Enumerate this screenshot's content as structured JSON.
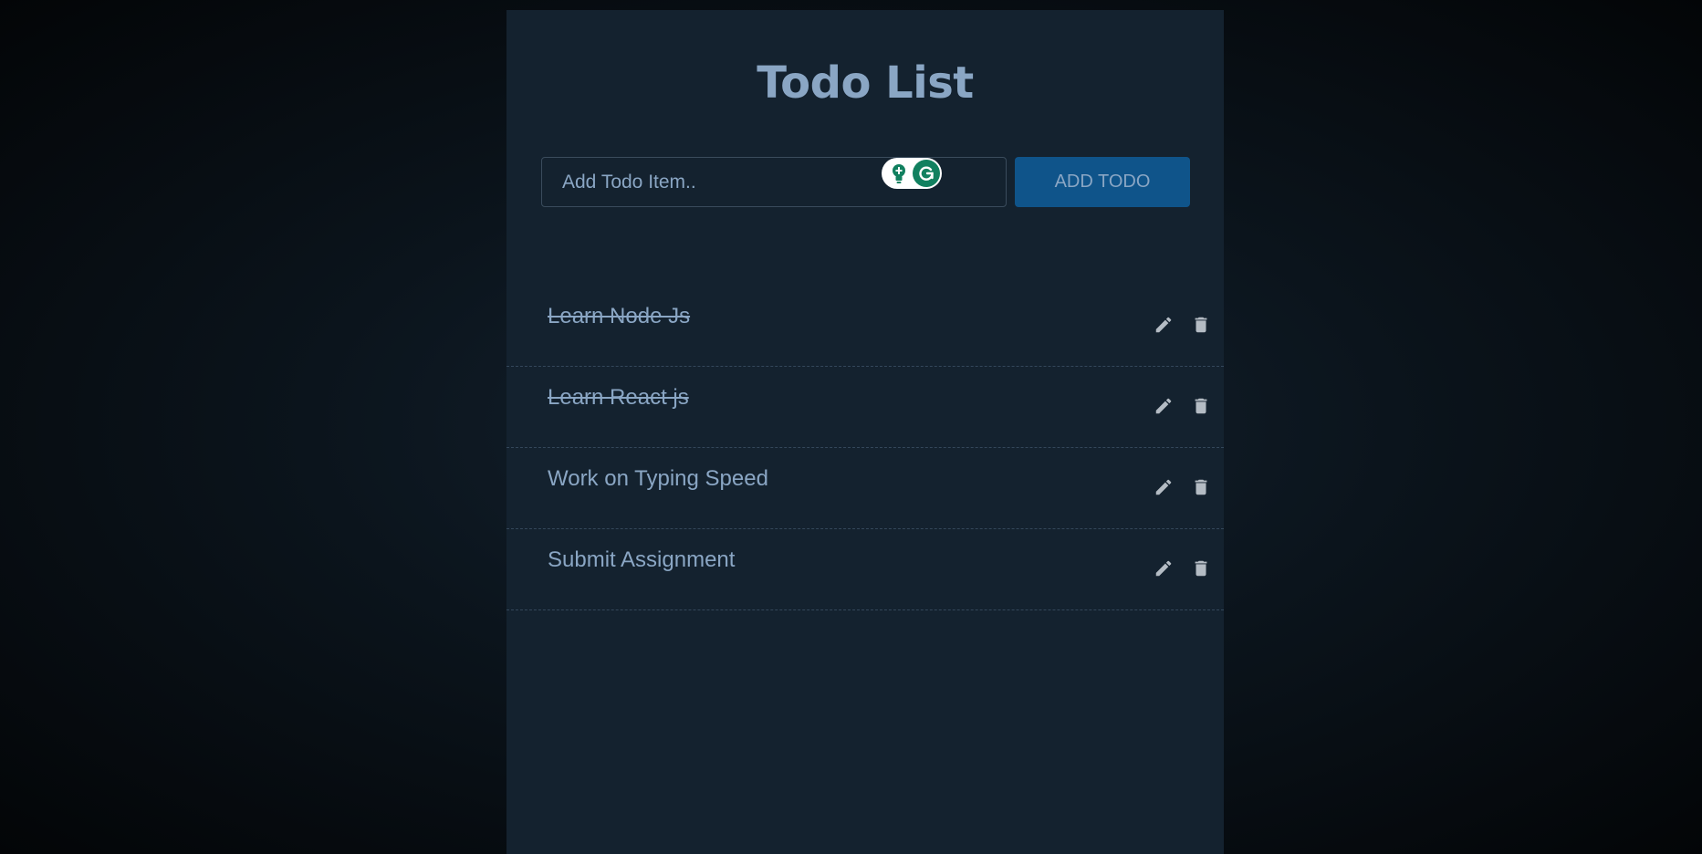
{
  "app": {
    "title": "Todo List"
  },
  "form": {
    "placeholder": "Add Todo Item..",
    "value": "",
    "add_label": "ADD TODO"
  },
  "todos": [
    {
      "text": "Learn Node Js",
      "completed": true
    },
    {
      "text": "Learn React js",
      "completed": true
    },
    {
      "text": "Work on Typing Speed",
      "completed": false
    },
    {
      "text": "Submit Assignment",
      "completed": false
    }
  ],
  "icons": {
    "edit": "pencil-icon",
    "delete": "trash-icon",
    "grammarly_suggest": "lightbulb-icon",
    "grammarly_logo": "grammarly-g-icon"
  },
  "colors": {
    "panel_bg": "#14222f",
    "text": "#8aa6c4",
    "button_bg": "#0f548a",
    "icon": "#b4bcc4",
    "grammarly_green": "#11805f"
  }
}
